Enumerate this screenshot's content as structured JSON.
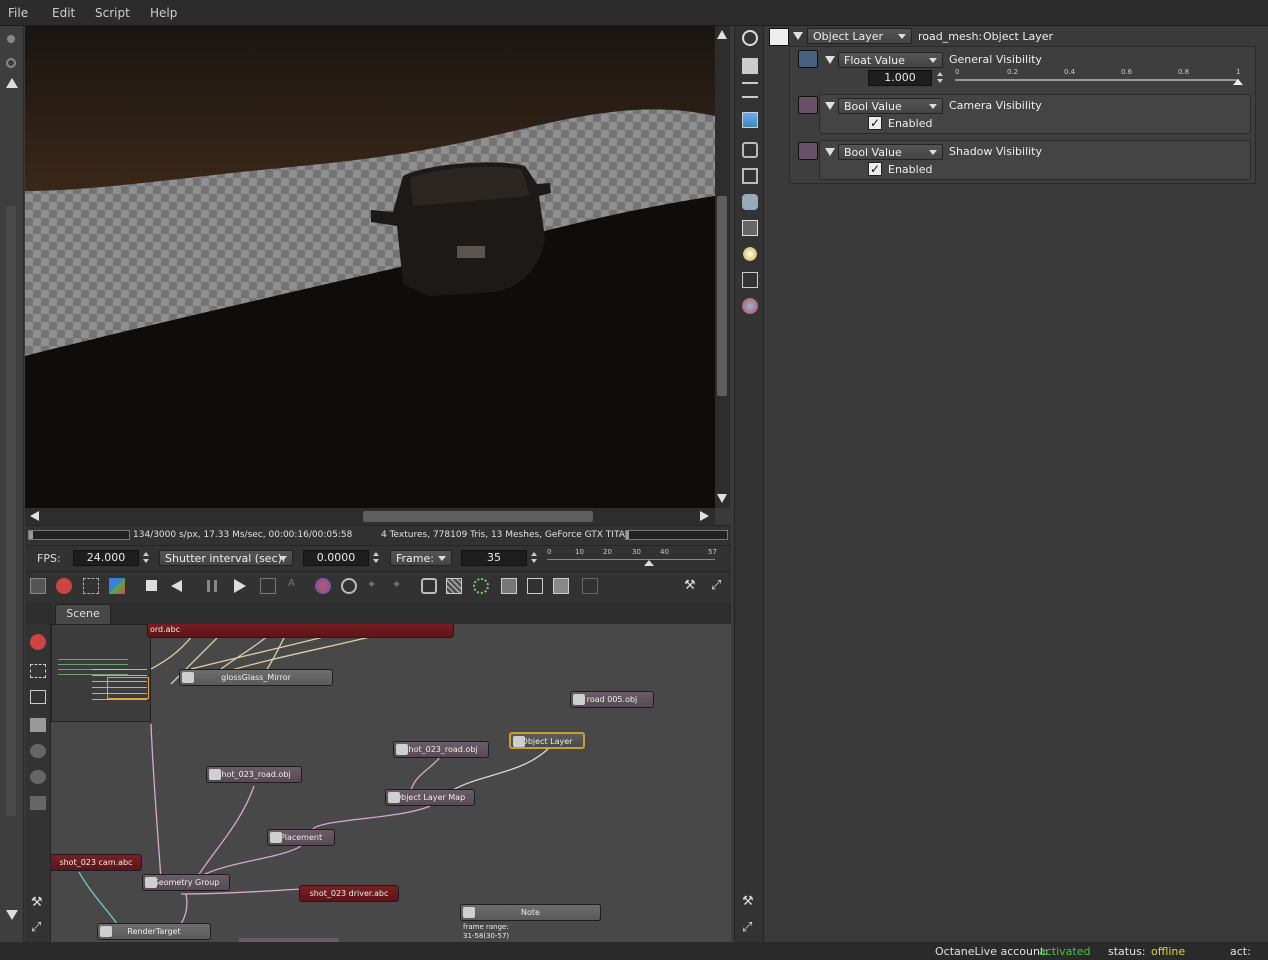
{
  "menu": [
    "File",
    "Edit",
    "Script",
    "Help"
  ],
  "inspector": {
    "node_type": "Object Layer",
    "node_label": "road_mesh:",
    "node_type2": "Object Layer",
    "params": [
      {
        "type": "Float Value",
        "name": "General Visibility",
        "value": "1.000",
        "slider_ticks": [
          "0",
          "0.2",
          "0.4",
          "0.6",
          "0.8",
          "1"
        ],
        "slider_fraction": 1.0
      },
      {
        "type": "Bool Value",
        "name": "Camera Visibility",
        "check_label": "Enabled",
        "checked": true
      },
      {
        "type": "Bool Value",
        "name": "Shadow Visibility",
        "check_label": "Enabled",
        "checked": true
      }
    ]
  },
  "render_stats": {
    "progress": "134/3000 s/px, 17.33 Ms/sec, 00:00:16/00:05:58",
    "scene_info": "4 Textures, 778109 Tris, 13 Meshes, GeForce GTX TITAN, ..."
  },
  "timeline": {
    "fps_label": "FPS:",
    "fps_value": "24.000",
    "shutter_label": "Shutter interval (sec):",
    "shutter_value": "0.0000",
    "frame_label": "Frame:",
    "frame_value": "35",
    "ticks": [
      "0",
      "10",
      "20",
      "30",
      "40",
      "57"
    ]
  },
  "node_graph": {
    "tab": "Scene",
    "nodes": {
      "ord_abc": "ord.abc",
      "glossy": "glossGlass_Mirror",
      "road005": "road 005.obj",
      "object_layer": "Object Layer",
      "shot_road_1": "shot_023_road.obj",
      "shot_road_2": "shot_023_road.obj",
      "olm": "Object Layer Map",
      "placement": "Placement",
      "cam": "shot_023 cam.abc",
      "geo": "Geometry Group",
      "driver": "shot_023 driver.abc",
      "note": "Note",
      "note_text": "frame range:",
      "note_text2": "31-58(30-57)",
      "rt": "RenderTarget"
    }
  },
  "footer": {
    "account_label": "OctaneLive account:",
    "account_value": "activated",
    "status_label": "status:",
    "status_value": "offline",
    "act_label": "act:"
  },
  "colors": {
    "activated": "#3ec93e",
    "offline": "#d8d83a",
    "selected_node": "#c8a12a"
  }
}
